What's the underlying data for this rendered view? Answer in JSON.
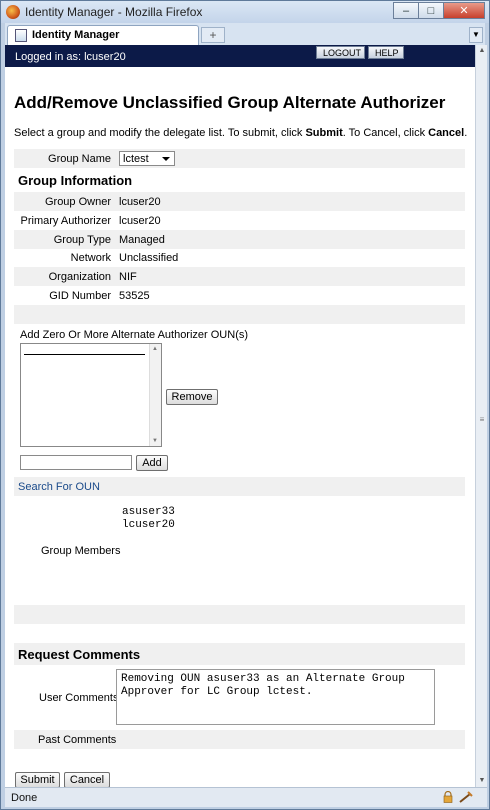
{
  "window": {
    "title": "Identity Manager - Mozilla Firefox",
    "minimize": "–",
    "maximize": "□",
    "close": "✕",
    "tab_title": "Identity Manager",
    "new_tab": "+",
    "tab_menu": "▼"
  },
  "header": {
    "logged_in": "Logged in as: lcuser20",
    "logout_label": "LOGOUT",
    "help_label": "HELP"
  },
  "page": {
    "title": "Add/Remove Unclassified Group Alternate Authorizer",
    "instructions_prefix": "Select a group and modify the delegate list. To submit, click ",
    "instructions_submit": "Submit",
    "instructions_middle": ". To Cancel, click ",
    "instructions_cancel": "Cancel",
    "instructions_suffix": "."
  },
  "group_select": {
    "label": "Group Name",
    "value": "lctest"
  },
  "group_info": {
    "heading": "Group Information",
    "fields": [
      {
        "label": "Group Owner",
        "value": "lcuser20"
      },
      {
        "label": "Primary Authorizer",
        "value": "lcuser20"
      },
      {
        "label": "Group Type",
        "value": "Managed"
      },
      {
        "label": "Network",
        "value": "Unclassified"
      },
      {
        "label": "Organization",
        "value": "NIF"
      },
      {
        "label": "GID Number",
        "value": "53525"
      }
    ]
  },
  "authorizers": {
    "label": "Add Zero Or More Alternate Authorizer OUN(s)",
    "remove_label": "Remove",
    "add_label": "Add",
    "add_input_value": "",
    "search_link": "Search For OUN"
  },
  "members": {
    "label": "Group Members",
    "list": [
      "asuser33",
      "lcuser20"
    ]
  },
  "comments": {
    "heading": "Request Comments",
    "user_label": "User Comments",
    "user_value_line1": "Removing OUN asuser33 as an Alternate Group",
    "user_value_line2": "Approver for LC Group lctest.",
    "past_label": "Past Comments"
  },
  "actions": {
    "submit_label": "Submit",
    "cancel_label": "Cancel"
  },
  "status": {
    "text": "Done"
  }
}
